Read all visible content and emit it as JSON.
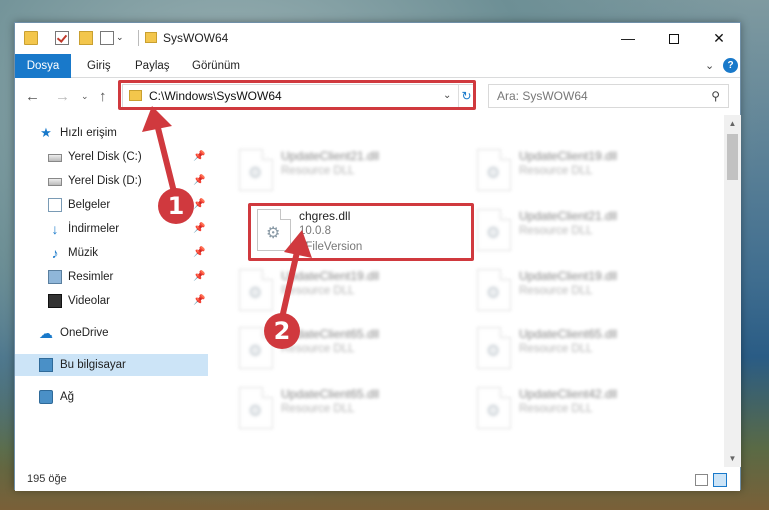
{
  "window": {
    "title": "SysWOW64",
    "minimize_icon": "minimize-icon",
    "maximize_icon": "maximize-icon",
    "close_icon": "close-icon",
    "minimize_glyph": "—",
    "close_glyph": "✕"
  },
  "ribbon": {
    "tabs": [
      {
        "label": "Dosya",
        "active": true
      },
      {
        "label": "Giriş"
      },
      {
        "label": "Paylaş"
      },
      {
        "label": "Görünüm"
      }
    ],
    "expand_glyph": "⌄",
    "help_glyph": "?"
  },
  "navigation": {
    "back_glyph": "←",
    "forward_glyph": "→",
    "recent_glyph": "⌄",
    "up_glyph": "↑",
    "address": "C:\\Windows\\SysWOW64",
    "address_dropdown_glyph": "⌄",
    "refresh_glyph": "↻",
    "search_placeholder": "Ara: SysWOW64",
    "search_glyph": "⚲"
  },
  "sidebar": {
    "items": [
      {
        "label": "Hızlı erişim",
        "icon": "star-icon",
        "glyph": "★"
      },
      {
        "label": "Yerel Disk (C:)",
        "icon": "disk-icon",
        "pinned": true
      },
      {
        "label": "Yerel Disk (D:)",
        "icon": "disk-icon",
        "pinned": true
      },
      {
        "label": "Belgeler",
        "icon": "document-icon",
        "pinned": true
      },
      {
        "label": "İndirmeler",
        "icon": "download-icon",
        "glyph": "↓",
        "pinned": true
      },
      {
        "label": "Müzik",
        "icon": "music-icon",
        "glyph": "♪",
        "pinned": true
      },
      {
        "label": "Resimler",
        "icon": "pictures-icon",
        "pinned": true
      },
      {
        "label": "Videolar",
        "icon": "video-icon",
        "pinned": true
      },
      {
        "label": "OneDrive",
        "icon": "cloud-icon",
        "glyph": "☁"
      },
      {
        "label": "Bu bilgisayar",
        "icon": "computer-icon",
        "selected": true
      },
      {
        "label": "Ağ",
        "icon": "network-icon"
      }
    ],
    "pin_glyph": "📌"
  },
  "files": {
    "highlighted": {
      "name": "chgres.dll",
      "version": "10.0.8",
      "description": "6FileVersion"
    },
    "background_items": [
      {
        "name": "UpdateClient21.dll",
        "type": "Resource DLL"
      },
      {
        "name": "UpdateClient19.dll",
        "type": "Resource DLL"
      },
      {
        "name": "UpdateClient21.dll",
        "type": "Resource DLL"
      },
      {
        "name": "UpdateClient19.dll",
        "type": "Resource DLL"
      },
      {
        "name": "UpdateClient19.dll",
        "type": "Resource DLL"
      },
      {
        "name": "UpdateClient65.dll",
        "type": "Resource DLL"
      },
      {
        "name": "UpdateClient65.dll",
        "type": "Resource DLL"
      },
      {
        "name": "UpdateClient65.dll",
        "type": "Resource DLL"
      },
      {
        "name": "UpdateClient42.dll",
        "type": "Resource DLL"
      }
    ],
    "gear_glyph": "⚙"
  },
  "scrollbar": {
    "up_glyph": "▲",
    "down_glyph": "▼"
  },
  "status": {
    "item_count": "195 öğe"
  },
  "annotations": {
    "marker_1": "1",
    "marker_2": "2",
    "color": "#d0393e"
  },
  "colors": {
    "accent": "#1979ca",
    "selection": "#cce4f7"
  }
}
